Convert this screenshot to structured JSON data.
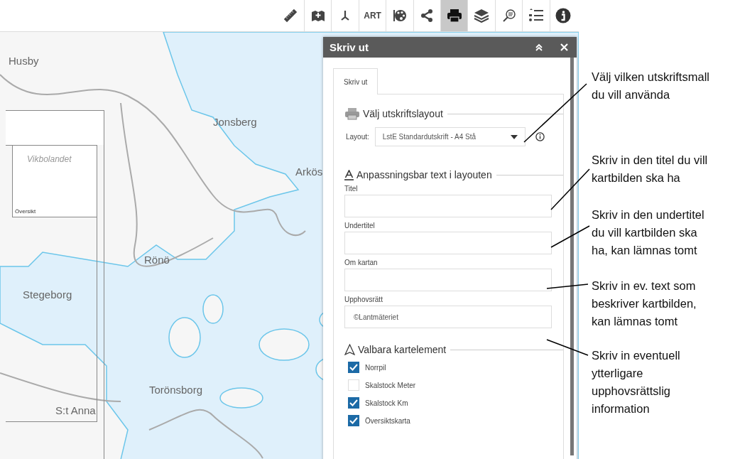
{
  "toolbar": [
    {
      "kind": "ruler",
      "selected": false
    },
    {
      "kind": "add-data",
      "selected": false
    },
    {
      "kind": "axes",
      "selected": false
    },
    {
      "kind": "text",
      "label": "ART",
      "selected": false
    },
    {
      "kind": "palette",
      "selected": false
    },
    {
      "kind": "share",
      "selected": false
    },
    {
      "kind": "print",
      "selected": true
    },
    {
      "kind": "layers",
      "selected": false
    },
    {
      "kind": "search",
      "selected": false
    },
    {
      "kind": "legend",
      "selected": false
    },
    {
      "kind": "info",
      "selected": false
    }
  ],
  "map": {
    "labels": [
      "Husby",
      "Jonsberg",
      "Arkös",
      "Rönö",
      "Stegeborg",
      "Torönsborg",
      "S:t Anna"
    ],
    "overview": {
      "title": "Översikt",
      "label": "Vikbolandet"
    }
  },
  "panel": {
    "title": "Skriv ut",
    "tabs": [
      {
        "label": "Skriv ut",
        "selected": true
      }
    ],
    "layout_section": {
      "legend": "Välj utskriftslayout",
      "label": "Layout:",
      "value": "LstE Standardutskrift - A4 Stå"
    },
    "text_section": {
      "legend": "Anpassningsbar text i layouten",
      "fields": [
        {
          "label": "Titel"
        },
        {
          "label": "Undertitel"
        },
        {
          "label": "Om kartan"
        },
        {
          "label": "Upphovsrätt",
          "value": "©Lantmäteriet"
        }
      ]
    },
    "elements_section": {
      "legend": "Valbara kartelement",
      "options": [
        {
          "label": "Norrpil",
          "checked": true
        },
        {
          "label": "Skalstock Meter",
          "checked": false
        },
        {
          "label": "Skalstock Km",
          "checked": true
        },
        {
          "label": "Översiktskarta",
          "checked": true
        }
      ]
    }
  },
  "annotations": [
    {
      "text": "Välj vilken utskriftsmall\ndu vill använda"
    },
    {
      "text": "Skriv in den titel du vill\nkartbilden ska ha"
    },
    {
      "text": "Skriv in den undertitel\ndu vill kartbilden ska\nha, kan lämnas tomt"
    },
    {
      "text": "Skriv in ev. text som\nbeskriver kartbilden,\nkan lämnas tomt"
    },
    {
      "text": "Skriv in eventuell\nytterligare\nupphovsrättslig\ninformation"
    }
  ]
}
